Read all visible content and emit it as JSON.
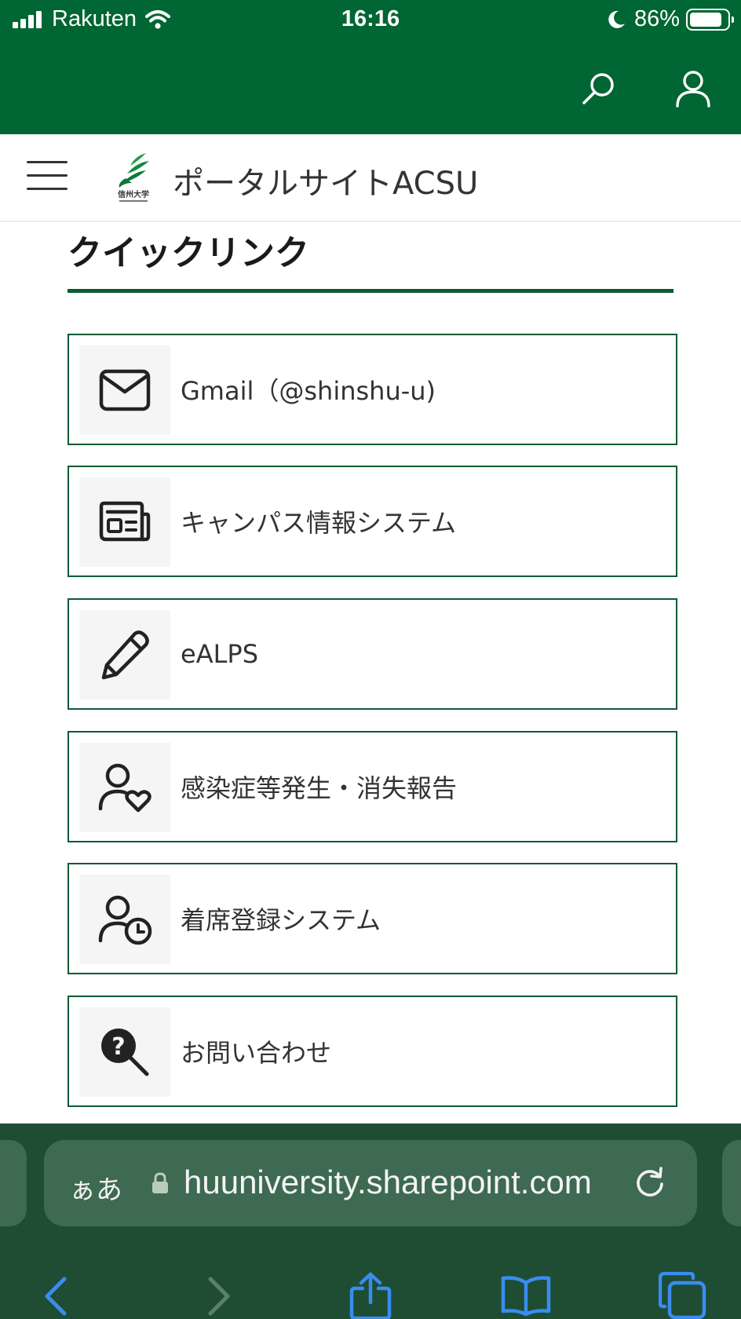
{
  "status_bar": {
    "carrier": "Rakuten",
    "time": "16:16",
    "battery_percent": "86%",
    "battery_level": 0.86,
    "icons": [
      "cellular-signal-icon",
      "wifi-icon",
      "moon-icon",
      "battery-icon"
    ]
  },
  "header": {
    "color": "#006633",
    "icons": [
      "search-icon",
      "user-icon"
    ]
  },
  "site_nav": {
    "menu_icon": "hamburger-icon",
    "logo_text": "信州大学",
    "title": "ポータルサイトACSU"
  },
  "quick_links": {
    "title": "クイックリンク",
    "items": [
      {
        "label": "Gmail（@shinshu-u)",
        "icon": "mail-icon"
      },
      {
        "label": "キャンパス情報システム",
        "icon": "newspaper-icon"
      },
      {
        "label": "eALPS",
        "icon": "pencil-icon"
      },
      {
        "label": "感染症等発生・消失報告",
        "icon": "person-heart-icon"
      },
      {
        "label": "着席登録システム",
        "icon": "person-clock-icon"
      },
      {
        "label": "お問い合わせ",
        "icon": "question-search-icon"
      }
    ]
  },
  "browser": {
    "text_size_button": "ぁあ",
    "url": "huuniversity.sharepoint.com",
    "icons": [
      "lock-icon",
      "reload-icon",
      "back-icon",
      "forward-icon",
      "share-icon",
      "bookmarks-icon",
      "tabs-icon"
    ]
  },
  "colors": {
    "brand_green": "#006633",
    "card_border": "#0f5a35",
    "toolbar_bg": "#1e4d34",
    "url_pill": "#3d6a50",
    "ios_blue": "#3a8cf0"
  }
}
